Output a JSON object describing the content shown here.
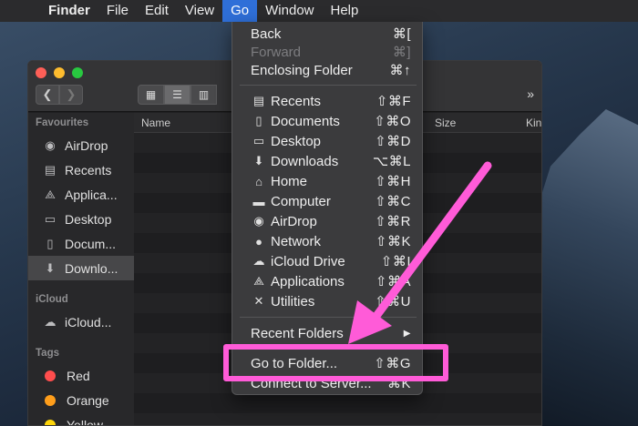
{
  "menubar": {
    "items": [
      {
        "label": "Finder",
        "bold": true
      },
      {
        "label": "File"
      },
      {
        "label": "Edit"
      },
      {
        "label": "View"
      },
      {
        "label": "Go",
        "active": true
      },
      {
        "label": "Window"
      },
      {
        "label": "Help"
      }
    ]
  },
  "window": {
    "toolbar": {
      "more_label": "»"
    },
    "columns": {
      "name": "Name",
      "size": "Size",
      "kind": "Kin"
    },
    "sidebar": {
      "favourites_header": "Favourites",
      "favourites": [
        {
          "label": "AirDrop",
          "icon": "airdrop-icon"
        },
        {
          "label": "Recents",
          "icon": "recents-icon"
        },
        {
          "label": "Applica...",
          "icon": "applications-icon"
        },
        {
          "label": "Desktop",
          "icon": "desktop-icon"
        },
        {
          "label": "Docum...",
          "icon": "documents-icon"
        },
        {
          "label": "Downlo...",
          "icon": "downloads-icon",
          "selected": true
        }
      ],
      "icloud_header": "iCloud",
      "icloud": [
        {
          "label": "iCloud...",
          "icon": "cloud-icon"
        }
      ],
      "tags_header": "Tags",
      "tags": [
        {
          "label": "Red",
          "color": "#ff4d4d"
        },
        {
          "label": "Orange",
          "color": "#ff9e1b"
        },
        {
          "label": "Yellow",
          "color": "#ffd60a"
        }
      ]
    }
  },
  "go_menu": {
    "back": {
      "label": "Back",
      "shortcut": "⌘["
    },
    "forward": {
      "label": "Forward",
      "shortcut": "⌘]"
    },
    "enclosing": {
      "label": "Enclosing Folder",
      "shortcut": "⌘↑"
    },
    "places": [
      {
        "label": "Recents",
        "shortcut": "⇧⌘F",
        "icon": "recents-icon"
      },
      {
        "label": "Documents",
        "shortcut": "⇧⌘O",
        "icon": "documents-icon"
      },
      {
        "label": "Desktop",
        "shortcut": "⇧⌘D",
        "icon": "desktop-icon"
      },
      {
        "label": "Downloads",
        "shortcut": "⌥⌘L",
        "icon": "downloads-icon"
      },
      {
        "label": "Home",
        "shortcut": "⇧⌘H",
        "icon": "home-icon"
      },
      {
        "label": "Computer",
        "shortcut": "⇧⌘C",
        "icon": "computer-icon"
      },
      {
        "label": "AirDrop",
        "shortcut": "⇧⌘R",
        "icon": "airdrop-icon"
      },
      {
        "label": "Network",
        "shortcut": "⇧⌘K",
        "icon": "network-icon"
      },
      {
        "label": "iCloud Drive",
        "shortcut": "⇧⌘I",
        "icon": "cloud-icon"
      },
      {
        "label": "Applications",
        "shortcut": "⇧⌘A",
        "icon": "applications-icon"
      },
      {
        "label": "Utilities",
        "shortcut": "⇧⌘U",
        "icon": "utilities-icon"
      }
    ],
    "recent_folders": {
      "label": "Recent Folders",
      "submenu_glyph": "▶"
    },
    "go_to_folder": {
      "label": "Go to Folder...",
      "shortcut": "⇧⌘G"
    },
    "connect": {
      "label": "Connect to Server...",
      "shortcut": "⌘K"
    }
  },
  "annotation": {
    "color": "#ff5bd8"
  }
}
